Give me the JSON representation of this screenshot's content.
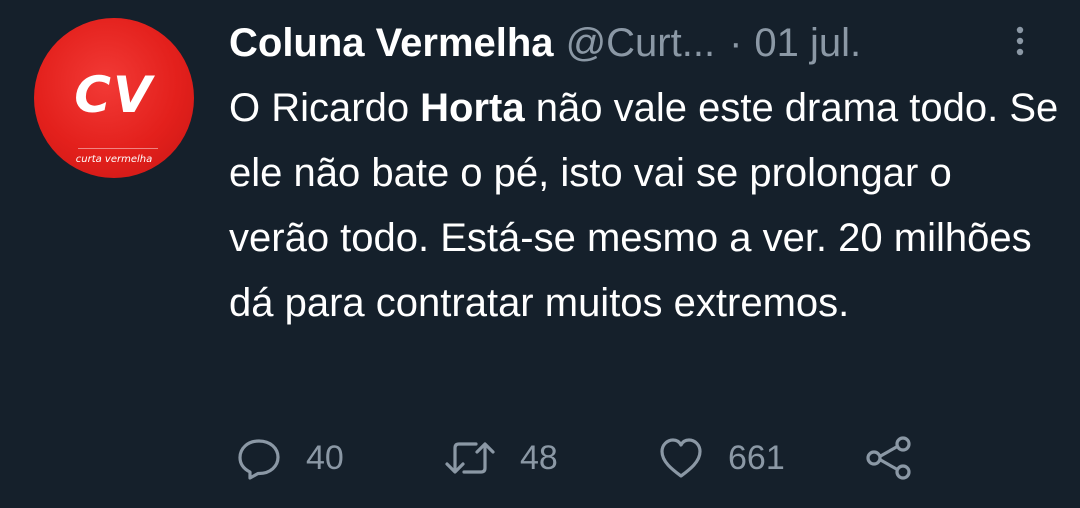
{
  "tweet": {
    "author": {
      "display_name": "Coluna Vermelha",
      "handle": "@Curt...",
      "avatar_initials": "CV",
      "avatar_subtitle": "curta vermelha"
    },
    "separator": "·",
    "date": "01 jul.",
    "text_parts": {
      "before": "O Ricardo ",
      "bold": "Horta",
      "after": " não vale este drama todo. Se ele não bate o pé, isto vai se prolongar o verão todo. Está-se mesmo a ver. 20 milhões dá para contratar muitos extremos."
    },
    "actions": {
      "replies": "40",
      "retweets": "48",
      "likes": "661"
    }
  },
  "colors": {
    "background": "#15202b",
    "text_primary": "#ffffff",
    "text_secondary": "#8b98a5",
    "avatar_red": "#e3201c"
  },
  "icons": [
    "more-vertical-icon",
    "reply-icon",
    "retweet-icon",
    "like-icon",
    "share-icon"
  ]
}
